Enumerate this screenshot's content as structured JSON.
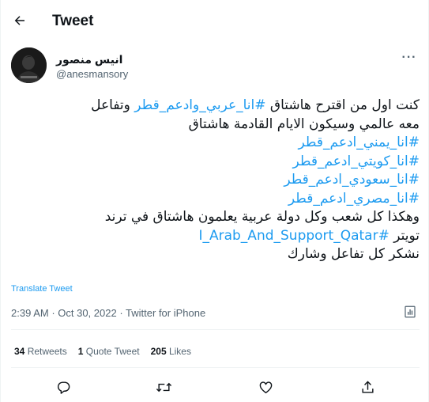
{
  "header": {
    "title": "Tweet",
    "back_icon": "arrow-left-icon"
  },
  "author": {
    "display_name": "انيس منصور",
    "username": "@anesmansory",
    "avatar_icon": "profile-avatar",
    "more_icon": "more-horizontal-icon",
    "more_label": "···"
  },
  "tweet": {
    "line1": "كنت اول من اقترح هاشتاق ",
    "line1_tag": "#انا_عربي_وادعم_قطر",
    "line1_end": " وتفاعل",
    "line2": "معه عالمي وسيكون الايام القادمة هاشتاق",
    "tags": [
      "#انا_يمني_ادعم_قطر",
      "#انا_كويتي_ادعم_قطر",
      "#انا_سعودي_ادعم_قطر",
      "#انا_مصري_ادعم_قطر"
    ],
    "line7": "وهكذا كل شعب وكل دولة عربية يعلمون هاشتاق في ترند",
    "line8_start": "تويتر ",
    "line8_tag": "#I_Arab_And_Support_Qatar",
    "line9": "نشكر كل تفاعل وشارك"
  },
  "translate_label": "Translate Tweet",
  "meta": {
    "time": "2:39 AM",
    "separator1": " · ",
    "date": "Oct 30, 2022",
    "separator2": " · ",
    "source": "Twitter for iPhone",
    "analytics_icon": "analytics-icon"
  },
  "stats": {
    "retweets_count": "34",
    "retweets_label": "Retweets",
    "quotes_count": "1",
    "quotes_label": "Quote Tweet",
    "likes_count": "205",
    "likes_label": "Likes"
  },
  "actions": {
    "reply_icon": "reply-icon",
    "retweet_icon": "retweet-icon",
    "like_icon": "like-icon",
    "share_icon": "share-icon"
  },
  "colors": {
    "accent": "#1d9bf0",
    "text_primary": "#0f1419",
    "text_secondary": "#536471",
    "border": "#eff3f4"
  }
}
